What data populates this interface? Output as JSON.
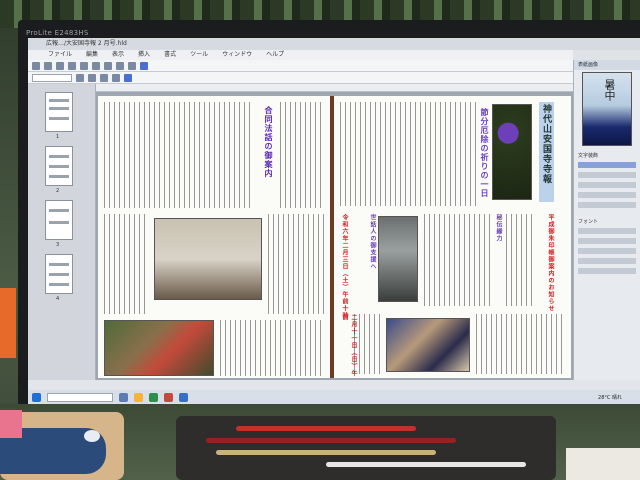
{
  "monitor": {
    "brand": "ProLite E2483HS"
  },
  "app": {
    "title": "広報…/大安国寺報 2 月号.hld",
    "menu": [
      "ファイル",
      "編集",
      "表示",
      "挿入",
      "書式",
      "ツール",
      "ウィンドウ",
      "ヘルプ"
    ],
    "font_value": "",
    "page_numbers": [
      "1",
      "2",
      "3",
      "4"
    ]
  },
  "newsletter": {
    "masthead": "神代山安国寺寺報",
    "headline_left": "合同法話の御案内",
    "headline_right_1": "節分厄除の祈りの一日",
    "headline_right_2": "世話人の御支援へ",
    "headline_right_3": "秘伝縁力",
    "red_notice": "令和六年二月三日（土）午前十時",
    "red_notice_2": "平成御朱印帳御案内のお知らせ",
    "date_notice": "二月十一日（日）午前"
  },
  "right_panel": {
    "header": "表紙画像",
    "cover_title": "暑中",
    "section_label": "文字装飾",
    "font_label": "フォント"
  },
  "status": {
    "text": ""
  },
  "taskbar": {
    "search_placeholder": "",
    "clock": "28°C 晴れ"
  }
}
